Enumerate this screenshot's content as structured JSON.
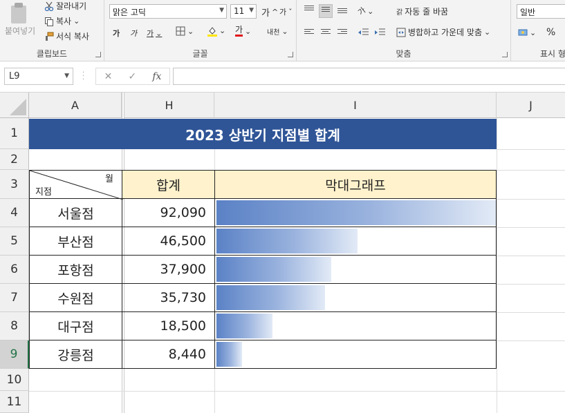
{
  "ribbon": {
    "clipboard": {
      "paste": "붙여넣기",
      "cut": "잘라내기",
      "copy": "복사",
      "format_painter": "서식 복사",
      "group_label": "클립보드"
    },
    "font": {
      "font_name": "맑은 고딕",
      "font_size": "11",
      "grow_glyph": "가",
      "shrink_glyph": "가",
      "bold_glyph": "가",
      "italic_glyph": "가",
      "underline_glyph": "가",
      "font_color_glyph": "가",
      "phonetic_glyph": "내천",
      "group_label": "글꼴"
    },
    "alignment": {
      "wrap_text": "자동 줄 바꿈",
      "merge_center": "병합하고 가운데 맞춤",
      "orientation_glyph": "가",
      "wrap_glyph": "갉",
      "group_label": "맞춤"
    },
    "number": {
      "format": "일반",
      "percent": "%",
      "group_label": "표시 형"
    }
  },
  "formula_bar": {
    "name_box": "L9",
    "cancel": "✕",
    "enter": "✓",
    "fx": "fx",
    "formula": ""
  },
  "columns": [
    "A",
    "H",
    "I",
    "J"
  ],
  "rows": [
    "1",
    "2",
    "3",
    "4",
    "5",
    "6",
    "7",
    "8",
    "9",
    "10",
    "11"
  ],
  "active_row": "9",
  "sheet": {
    "title": "2023 상반기 지점별 합계",
    "header": {
      "diag_top": "월",
      "diag_bottom": "지점",
      "total": "합계",
      "bar": "막대그래프"
    },
    "records": [
      {
        "branch": "서울점",
        "total": "92,090",
        "value": 92090
      },
      {
        "branch": "부산점",
        "total": "46,500",
        "value": 46500
      },
      {
        "branch": "포항점",
        "total": "37,900",
        "value": 37900
      },
      {
        "branch": "수원점",
        "total": "35,730",
        "value": 35730
      },
      {
        "branch": "대구점",
        "total": "18,500",
        "value": 18500
      },
      {
        "branch": "강릉점",
        "total": "8,440",
        "value": 8440
      }
    ],
    "bar_scale_max": 92090,
    "bar_color_start": "#5b82c6",
    "bar_color_end": "#e2eaf6",
    "title_fill": "#2f5597",
    "header_fill": "#fff2cc"
  }
}
